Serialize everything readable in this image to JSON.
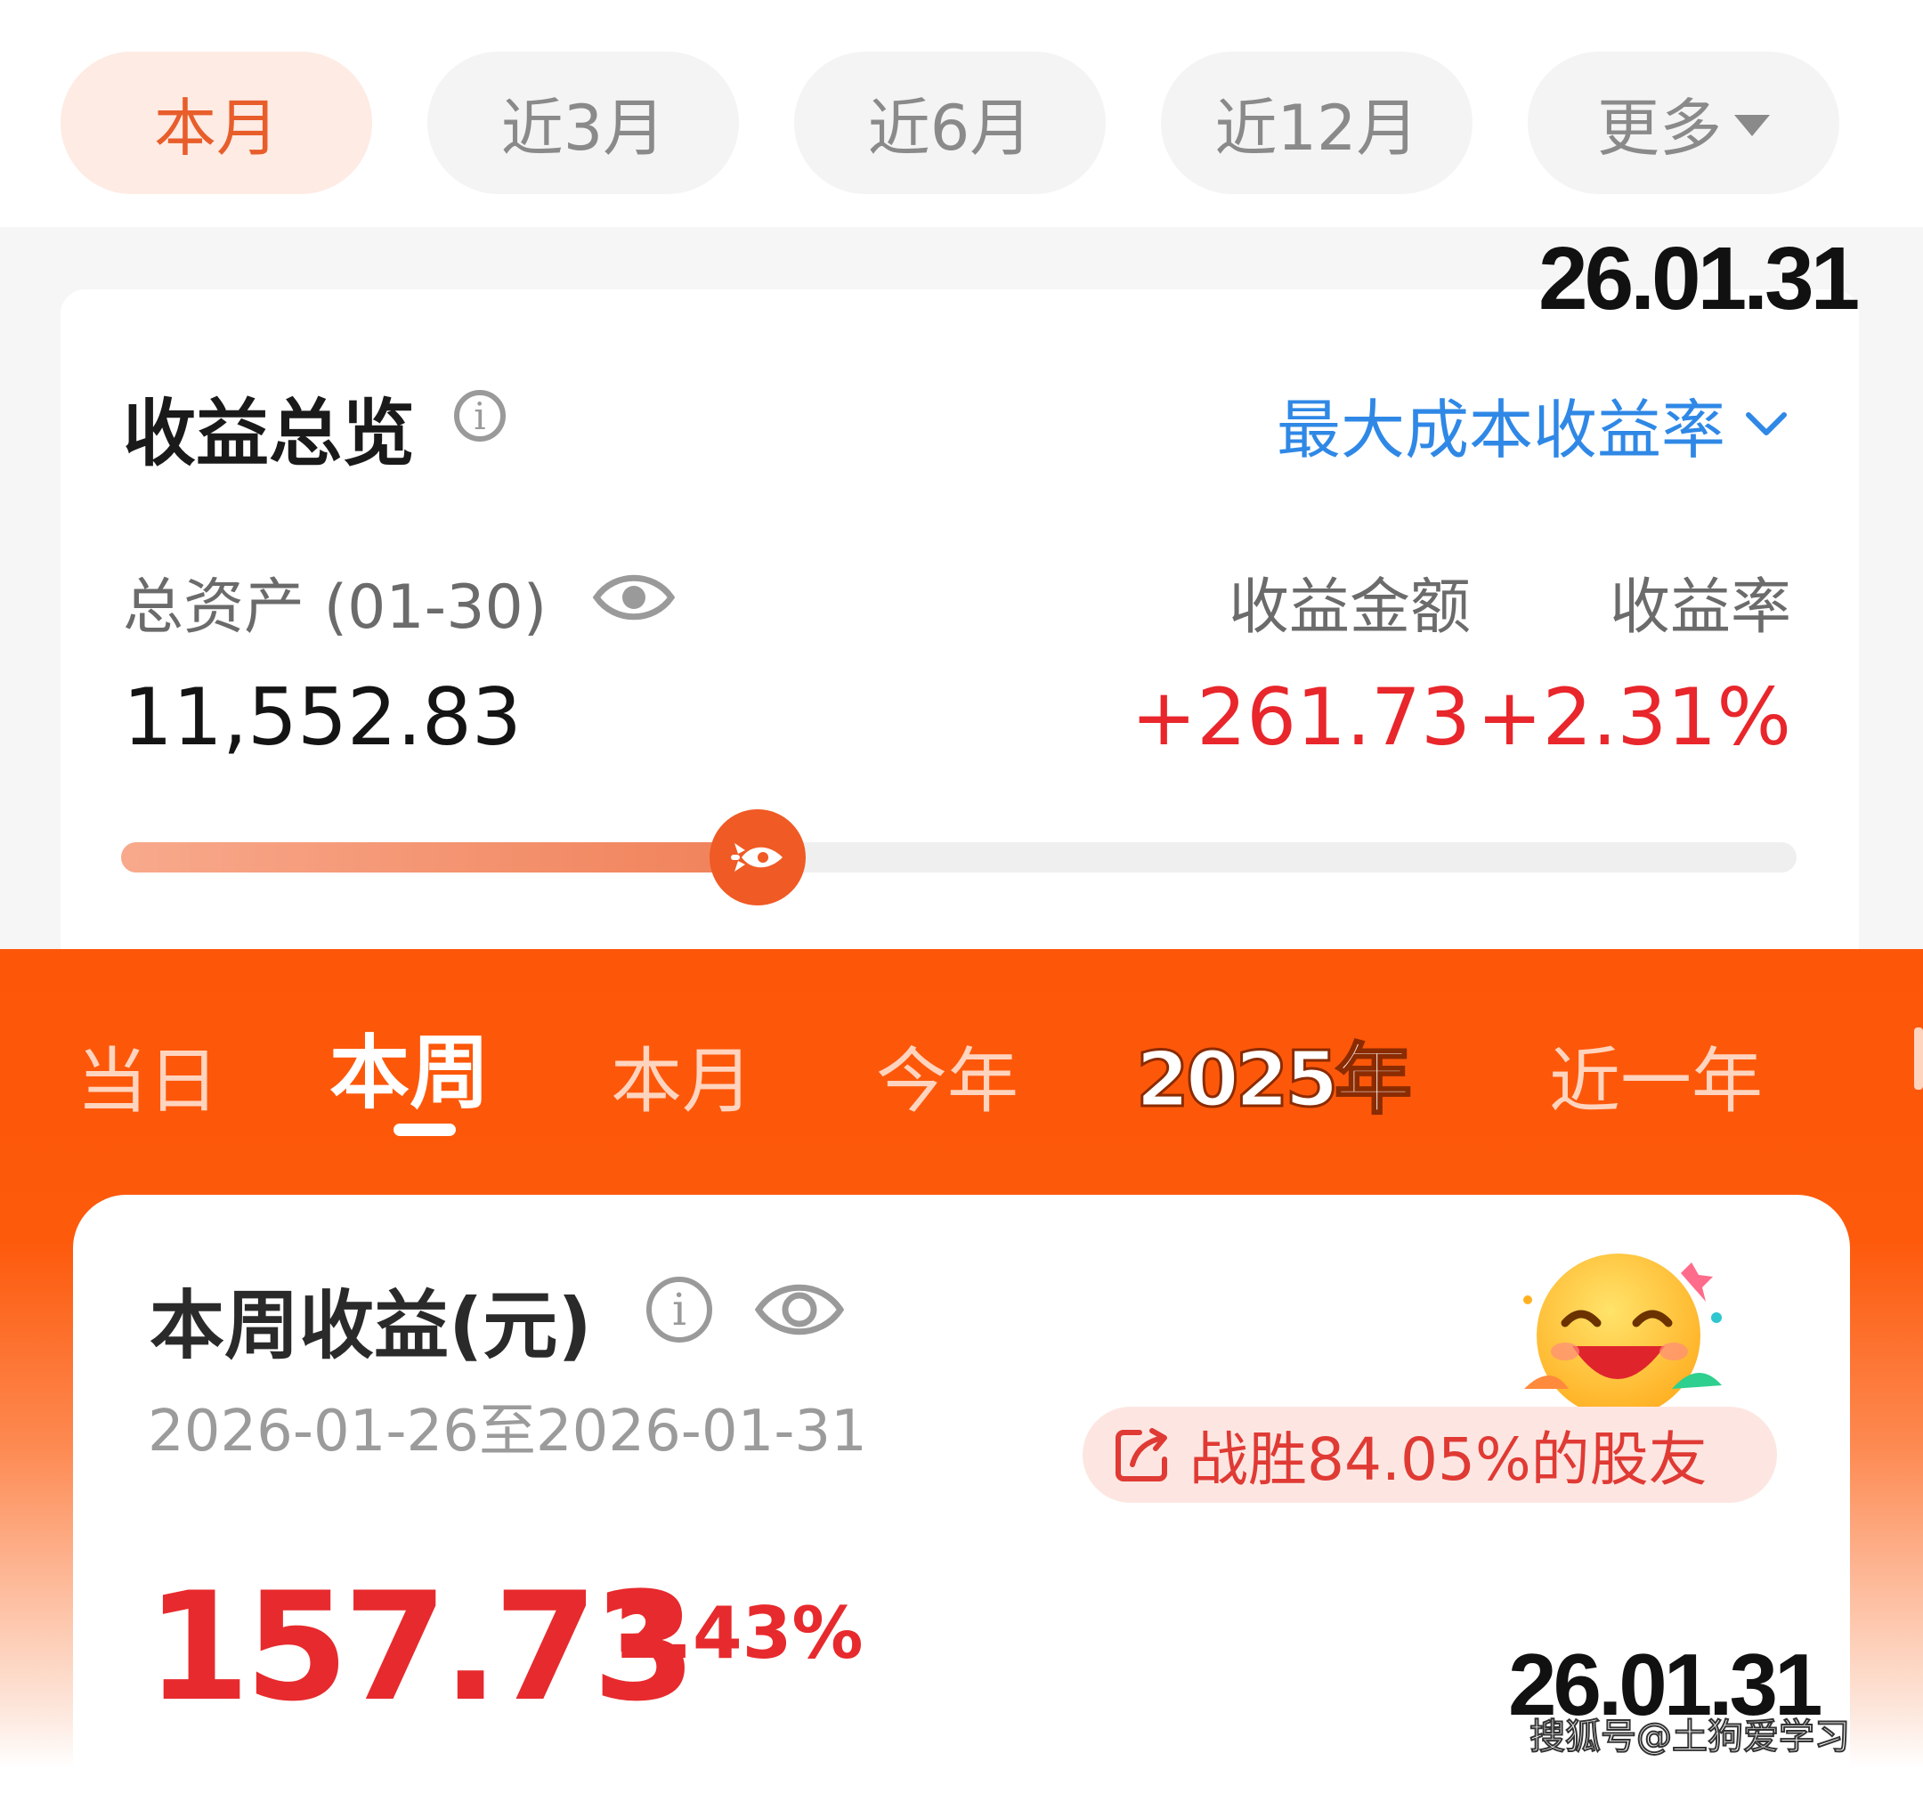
{
  "period_tabs": {
    "items": [
      {
        "label": "本月",
        "active": true
      },
      {
        "label": "近3月",
        "active": false
      },
      {
        "label": "近6月",
        "active": false
      },
      {
        "label": "近12月",
        "active": false
      },
      {
        "label": "更多",
        "active": false,
        "icon": "caret-down-icon"
      }
    ]
  },
  "overlay_dates": {
    "top": "26.01.31",
    "bottom": "26.01.31"
  },
  "overview": {
    "title": "收益总览",
    "metric_selector": "最大成本收益率",
    "total_assets_label": "总资产 (01-30)",
    "total_assets_value": "11,552.83",
    "profit_amount_label": "收益金额",
    "profit_amount_value": "+261.73",
    "profit_rate_label": "收益率",
    "profit_rate_value": "+2.31%",
    "progress_fraction": 0.38
  },
  "range_tabs": {
    "items": [
      {
        "label": "当日",
        "active": false
      },
      {
        "label": "本周",
        "active": true
      },
      {
        "label": "本月",
        "active": false
      },
      {
        "label": "今年",
        "active": false
      },
      {
        "label": "2025年",
        "active": false
      },
      {
        "label": "近一年",
        "active": false
      }
    ]
  },
  "weekly": {
    "title": "本周收益(元)",
    "date_range": "2026-01-26至2026-01-31",
    "beat_text": "战胜84.05%的股友",
    "profit_value": "157.73",
    "profit_rate": "2.43%"
  },
  "watermark": "搜狐号@土狗爱学习",
  "colors": {
    "accent_orange": "#fd5608",
    "profit_red": "#e8262b",
    "link_blue": "#2f88e6"
  }
}
